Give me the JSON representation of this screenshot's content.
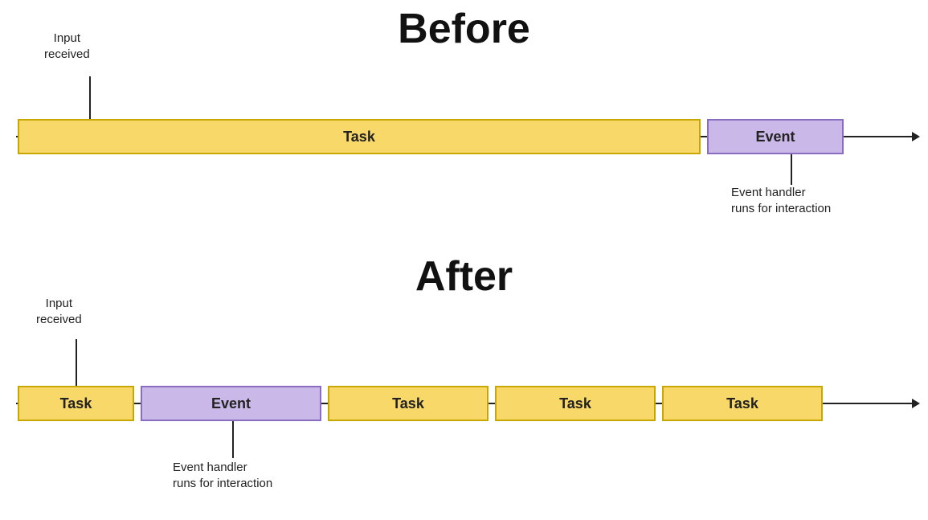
{
  "before": {
    "title": "Before",
    "input_label": "Input\nreceived",
    "task_label": "Task",
    "event_label": "Event",
    "annotation": "Event handler\nruns for interaction"
  },
  "after": {
    "title": "After",
    "input_label": "Input\nreceived",
    "task_label": "Task",
    "event_label": "Event",
    "annotation": "Event handler\nruns for interaction"
  }
}
